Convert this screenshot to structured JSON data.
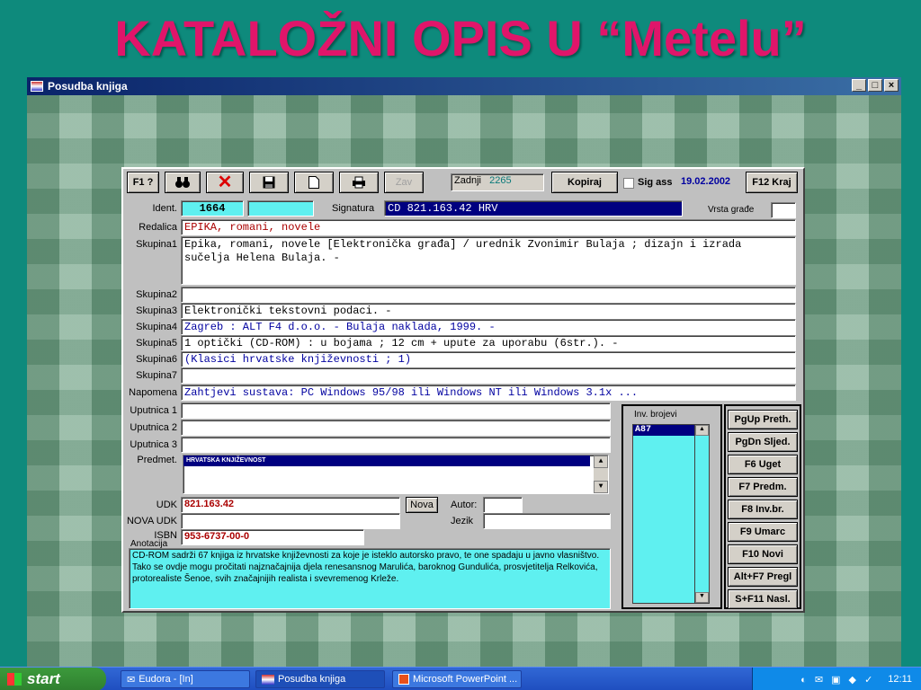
{
  "slide_title": "KATALOŽNI OPIS U “Metelu”",
  "window": {
    "title": "Posudba knjiga"
  },
  "toolbar": {
    "f1": "F1 ?",
    "zav": "Zav",
    "zadnji_label": "Zadnji",
    "zadnji_value": "2265",
    "kopiraj": "Kopiraj",
    "sig_ass": "Sig ass",
    "date": "19.02.2002",
    "f12": "F12 Kraj"
  },
  "form": {
    "ident_label": "Ident.",
    "ident_value": "1664",
    "signatura_label": "Signatura",
    "signatura_value": "CD 821.163.42 HRV",
    "vrsta_label": "Vrsta građe",
    "redalica_label": "Redalica",
    "redalica_value": "EPIKA, romani, novele",
    "skupina1_label": "Skupina1",
    "skupina1_value": "Epika, romani, novele [Elektronička građa] / urednik Zvonimir Bulaja ; dizajn i izrada sučelja Helena Bulaja. -",
    "skupina2_label": "Skupina2",
    "skupina2_value": "",
    "skupina3_label": "Skupina3",
    "skupina3_value": "Elektronički tekstovni podaci. -",
    "skupina4_label": "Skupina4",
    "skupina4_value": "Zagreb : ALT F4 d.o.o. - Bulaja naklada, 1999. -",
    "skupina5_label": "Skupina5",
    "skupina5_value": "1 optički (CD-ROM) : u bojama ; 12 cm + upute za uporabu (6str.). -",
    "skupina6_label": "Skupina6",
    "skupina6_value": "(Klasici hrvatske književnosti ; 1)",
    "skupina7_label": "Skupina7",
    "skupina7_value": "",
    "napomena_label": "Napomena",
    "napomena_value": "Zahtjevi sustava: PC Windows 95/98 ili Windows NT ili Windows 3.1x ...",
    "uputnica1_label": "Uputnica 1",
    "uputnica2_label": "Uputnica 2",
    "uputnica3_label": "Uputnica 3",
    "predmet_label": "Predmet.",
    "predmet_value": "HRVATSKA KNJIŽEVNOST",
    "udk_label": "UDK",
    "udk_value": "821.163.42",
    "nova_btn": "Nova",
    "autor_label": "Autor:",
    "nova_udk_label": "NOVA UDK",
    "jezik_label": "Jezik",
    "isbn_label": "ISBN",
    "isbn_value": "953-6737-00-0",
    "anotacija_label": "Anotacija",
    "anotacija_value": "CD-ROM sadrži 67 knjiga iz hrvatske književnosti za koje je isteklo autorsko pravo, te one spadaju u javno vlasništvo. Tako se ovdje mogu pročitati najznačajnija djela renesansnog Marulića, baroknog Gundulića, prosvjetitelja Relkovića, protorealiste Šenoe,  svih značajnijih realista i svevremenog Krleže.",
    "inv_label": "Inv. brojevi",
    "inv_value": "A87"
  },
  "side_buttons": [
    "PgUp Preth.",
    "PgDn Sljed.",
    "F6 Uget",
    "F7 Predm.",
    "F8 Inv.br.",
    "F9 Umarc",
    "F10 Novi",
    "Alt+F7 Pregl",
    "S+F11 Nasl."
  ],
  "taskbar": {
    "start": "start",
    "tasks": [
      "Eudora - [In]",
      "Posudba knjiga",
      "Microsoft PowerPoint ..."
    ],
    "clock": "12:11"
  },
  "colors": {
    "background": "#0e8a7c",
    "title": "#e0156a",
    "field_highlight": "#5ff0f0",
    "titlebar": "#0a246a"
  }
}
